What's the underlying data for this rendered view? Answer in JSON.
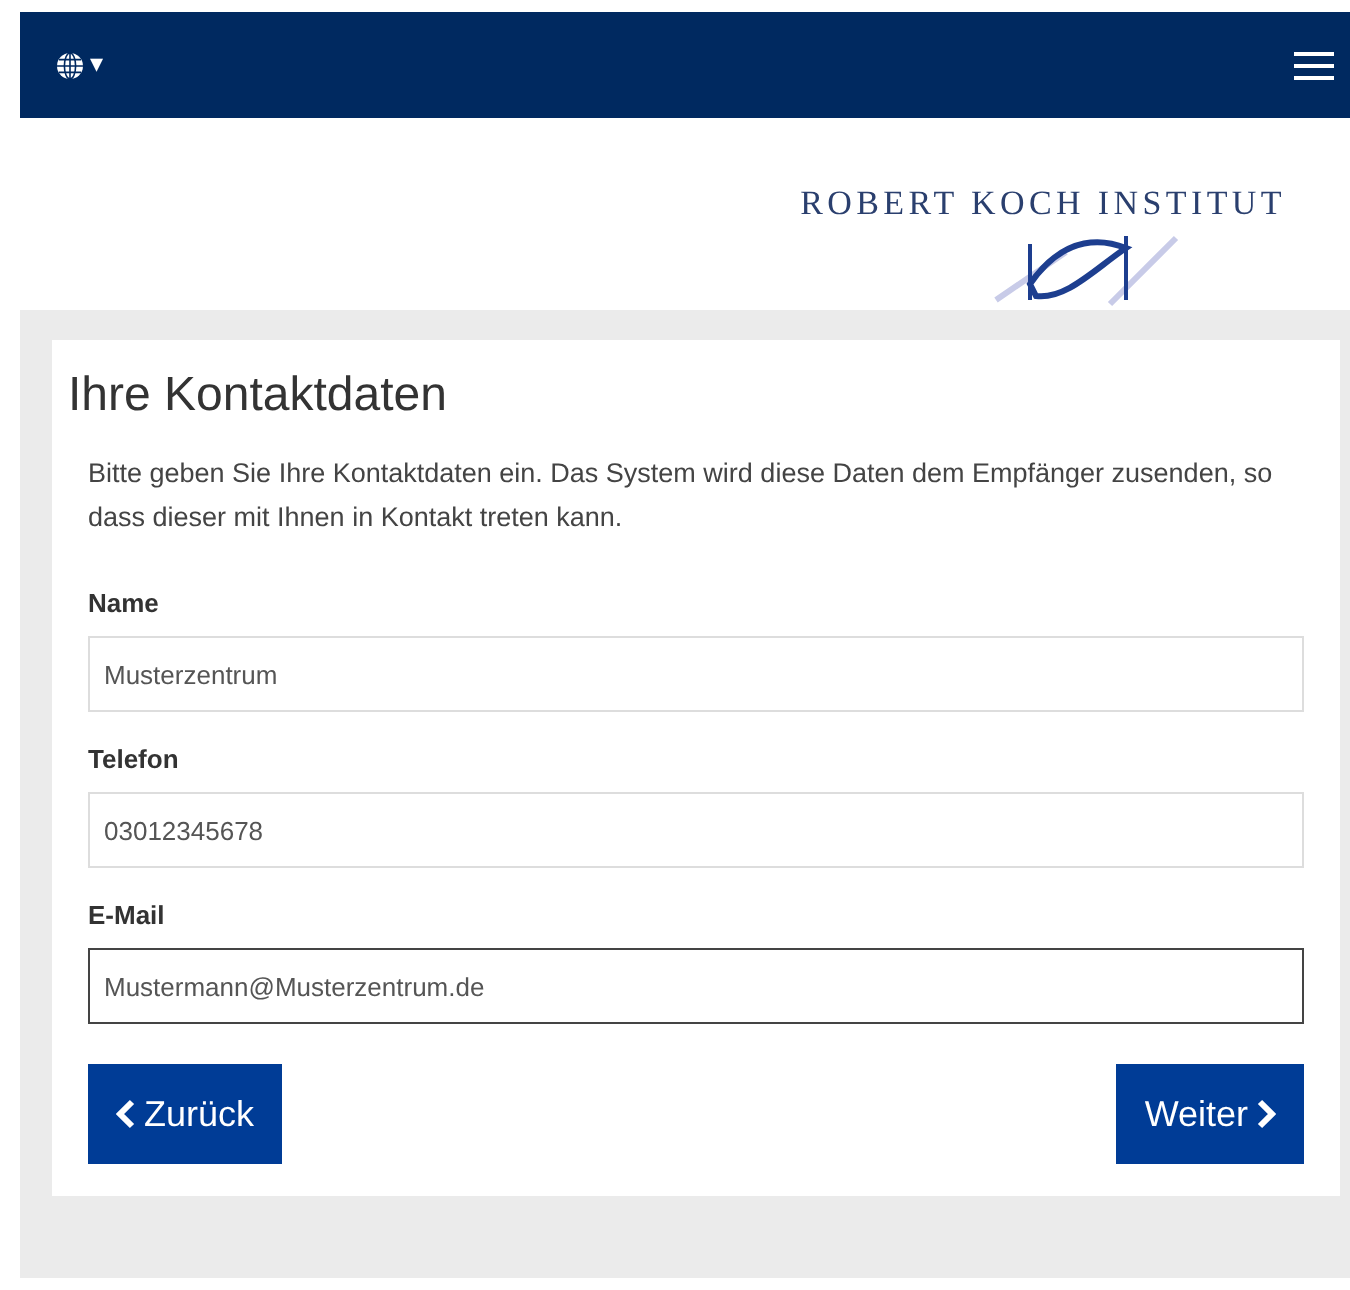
{
  "navbar": {
    "language_caret": "▾"
  },
  "header": {
    "logo_text": "ROBERT KOCH INSTITUT"
  },
  "form": {
    "title": "Ihre Kontaktdaten",
    "intro": "Bitte geben Sie Ihre Kontaktdaten ein. Das System wird diese Daten dem Empfänger zusenden, so dass dieser mit Ihnen in Kontakt treten kann.",
    "fields": [
      {
        "label": "Name",
        "value": "Musterzentrum",
        "focused": false
      },
      {
        "label": "Telefon",
        "value": "03012345678",
        "focused": false
      },
      {
        "label": "E-Mail",
        "value": "Mustermann@Musterzentrum.de",
        "focused": true
      }
    ],
    "buttons": [
      {
        "kind": "back",
        "label": "Zurück"
      },
      {
        "kind": "next",
        "label": "Weiter"
      }
    ]
  }
}
